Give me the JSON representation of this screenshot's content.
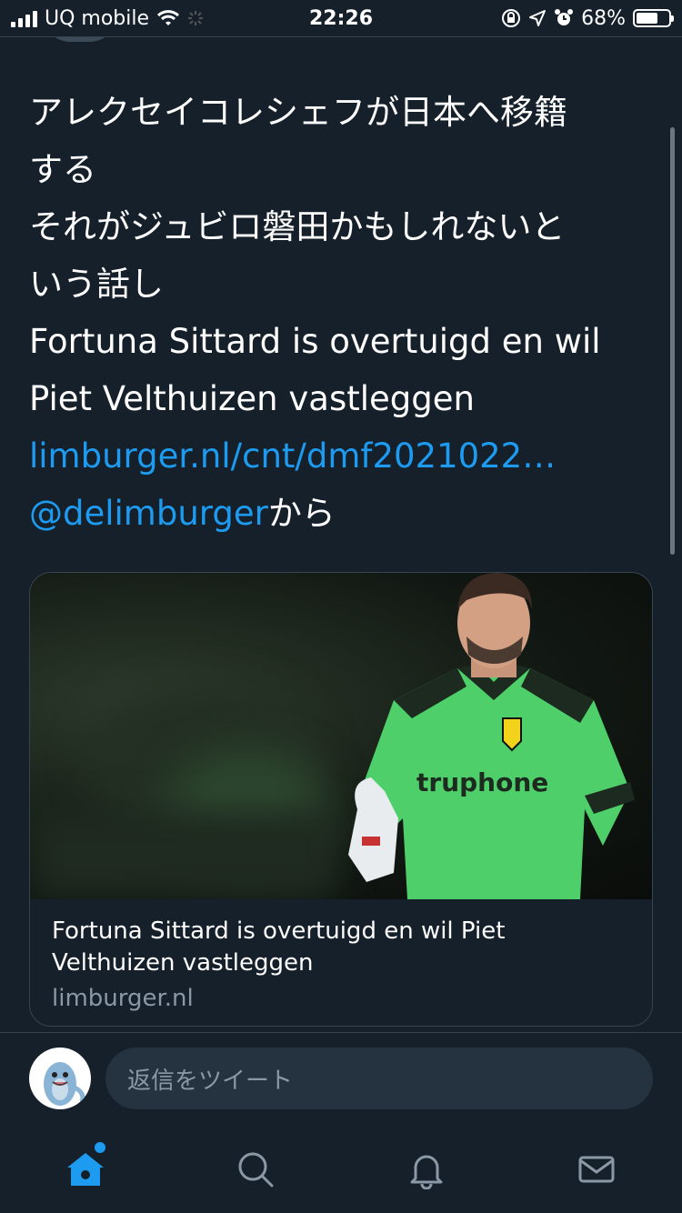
{
  "status_bar": {
    "carrier": "UQ mobile",
    "time": "22:26",
    "battery_percent": "68%",
    "battery_level": 0.68
  },
  "tweet": {
    "lines": [
      "アレクセイコレシェフが日本へ移籍",
      "する",
      "それがジュビロ磐田かもしれないと",
      "いう話し",
      "Fortuna Sittard is overtuigd en wil",
      "Piet Velthuizen vastleggen"
    ],
    "link_text": "limburger.nl/cnt/dmf2021022…",
    "mention": "@delimburger",
    "mention_suffix": "から"
  },
  "card": {
    "title": "Fortuna Sittard is overtuigd en wil Piet Velthuizen vastleggen",
    "domain": "limburger.nl",
    "image_subject": "goalkeeper in green jersey"
  },
  "reply": {
    "placeholder": "返信をツイート"
  },
  "tab_bar": {
    "items": [
      "home-icon",
      "search-icon",
      "bell-icon",
      "mail-icon"
    ],
    "active": "home-icon",
    "accent_color": "#1d9bf0"
  },
  "colors": {
    "background": "#15202b",
    "link": "#1d9bf0",
    "secondary_text": "#8b98a5",
    "divider": "#38444d"
  }
}
